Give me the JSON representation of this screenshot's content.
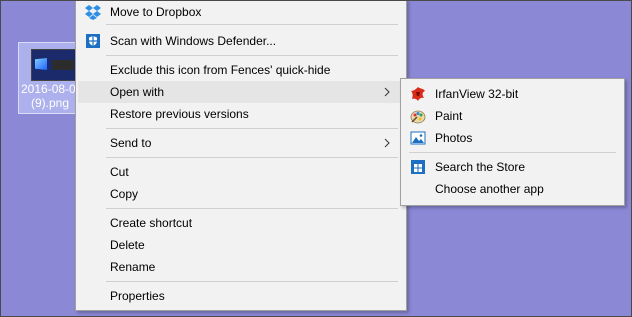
{
  "desktop": {
    "file_icon": {
      "label_line1": "2016-08-0",
      "label_line2": "(9).png"
    }
  },
  "context_menu": {
    "items": [
      {
        "label": "Move to Dropbox",
        "icon": "dropbox-icon"
      },
      {
        "label": "Scan with Windows Defender...",
        "icon": "windows-defender-icon"
      },
      {
        "label": "Exclude this icon from Fences' quick-hide"
      },
      {
        "label": "Open with",
        "has_submenu": true,
        "highlighted": true
      },
      {
        "label": "Restore previous versions"
      },
      {
        "label": "Send to",
        "has_submenu": true
      },
      {
        "label": "Cut"
      },
      {
        "label": "Copy"
      },
      {
        "label": "Create shortcut"
      },
      {
        "label": "Delete"
      },
      {
        "label": "Rename"
      },
      {
        "label": "Properties"
      }
    ]
  },
  "open_with_submenu": {
    "items": [
      {
        "label": "IrfanView 32-bit",
        "icon": "irfanview-icon"
      },
      {
        "label": "Paint",
        "icon": "paint-icon"
      },
      {
        "label": "Photos",
        "icon": "photos-icon"
      },
      {
        "label": "Search the Store",
        "icon": "store-icon"
      },
      {
        "label": "Choose another app"
      }
    ]
  },
  "colors": {
    "desktop_background": "#8b88d6",
    "menu_background": "#f2f2f2",
    "menu_highlight": "#e5e5e5",
    "menu_border": "#a0a0a0"
  }
}
